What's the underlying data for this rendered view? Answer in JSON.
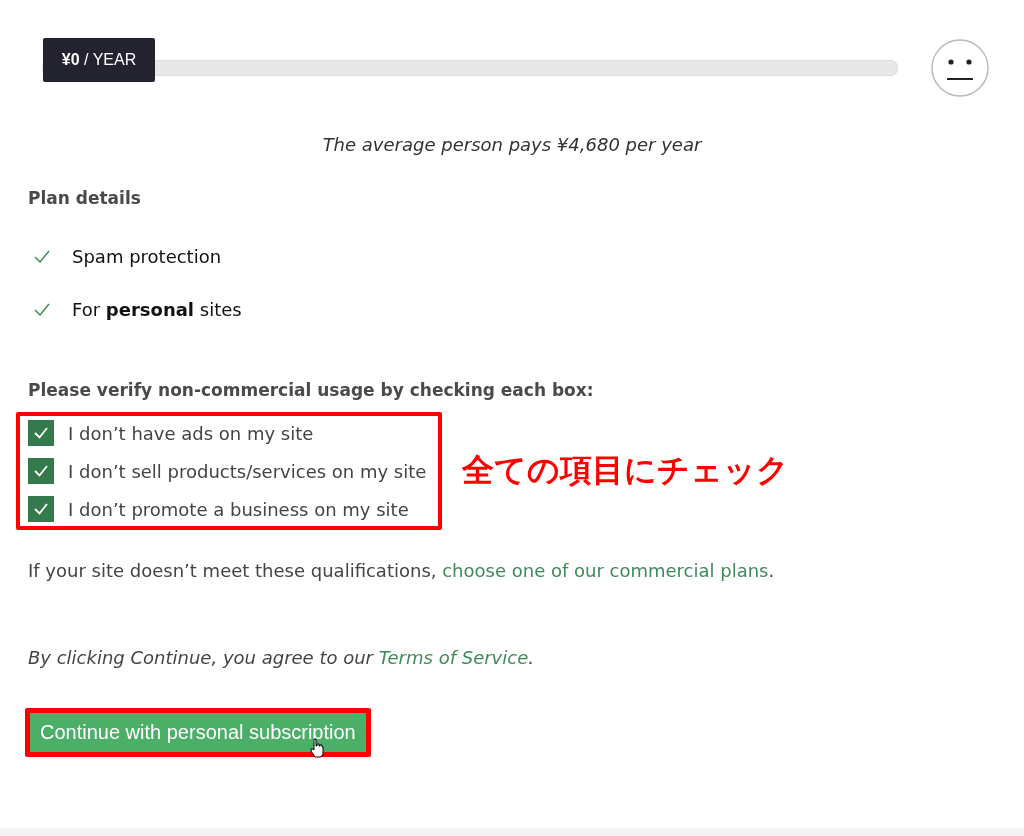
{
  "slider": {
    "price_label": "**¥0** / YEAR",
    "level": 0
  },
  "average_note": "The average person pays ¥4,680 per year",
  "plan_details": {
    "heading": "Plan details",
    "features": [
      {
        "text": "Spam protection"
      },
      {
        "text": "For **personal** sites"
      }
    ]
  },
  "verification": {
    "heading": "Please verify non-commercial usage by checking each box:",
    "checkboxes": [
      {
        "label": "I don’t have ads on my site",
        "checked": true
      },
      {
        "label": "I don’t sell products/services on my site",
        "checked": true
      },
      {
        "label": "I don’t promote a business on my site",
        "checked": true
      }
    ],
    "annotation": "全ての項目にチェック"
  },
  "qualification_note": {
    "text": "If your site doesn’t meet these qualifications, ",
    "link": "choose one of our commercial plans",
    "end": "."
  },
  "terms_note": {
    "text": "By clicking Continue, you agree to our ",
    "link": "Terms of Service",
    "end": "."
  },
  "continue_button": "Continue with personal subscription"
}
